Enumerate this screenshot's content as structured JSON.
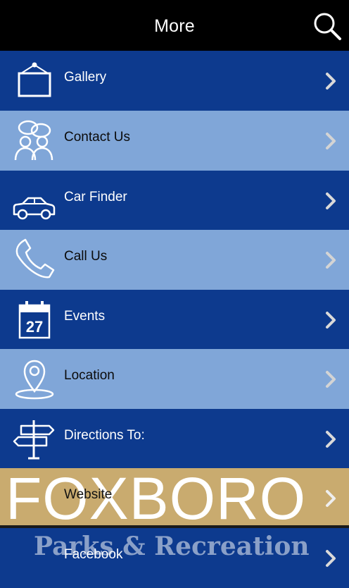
{
  "header": {
    "title": "More",
    "search_icon": "search-icon"
  },
  "menu": {
    "items": [
      {
        "label": "Gallery",
        "icon": "picture-frame-icon"
      },
      {
        "label": "Contact Us",
        "icon": "people-chat-icon"
      },
      {
        "label": "Car Finder",
        "icon": "car-icon"
      },
      {
        "label": "Call Us",
        "icon": "phone-icon"
      },
      {
        "label": "Events",
        "icon": "calendar-icon",
        "calendar_day": "27"
      },
      {
        "label": "Location",
        "icon": "map-pin-icon"
      },
      {
        "label": "Directions To:",
        "icon": "signpost-icon"
      },
      {
        "label": "Website",
        "banner_text": "FOXBORO"
      },
      {
        "label": "Facebook",
        "banner_text": "Parks & Recreation"
      }
    ]
  },
  "colors": {
    "header_bg": "#000000",
    "row_dark": "#0d3a8e",
    "row_light": "#80a6d8",
    "banner_tan": "#c9ab6f"
  }
}
